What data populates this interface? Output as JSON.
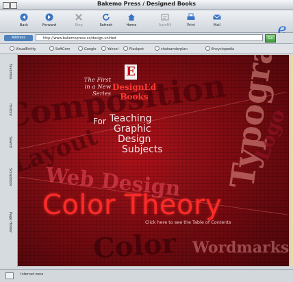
{
  "window": {
    "title": "Bakemo Press / Designed Books"
  },
  "toolbar": {
    "buttons": [
      {
        "label": "Back",
        "icon": "back-arrow-icon",
        "enabled": true
      },
      {
        "label": "Forward",
        "icon": "forward-arrow-icon",
        "enabled": true
      },
      {
        "label": "Stop",
        "icon": "stop-icon",
        "enabled": false
      },
      {
        "label": "Refresh",
        "icon": "refresh-icon",
        "enabled": true
      },
      {
        "label": "Home",
        "icon": "home-icon",
        "enabled": true
      },
      {
        "label": "AutoFill",
        "icon": "autofill-icon",
        "enabled": false
      },
      {
        "label": "Print",
        "icon": "print-icon",
        "enabled": true
      },
      {
        "label": "Mail",
        "icon": "mail-icon",
        "enabled": true
      }
    ]
  },
  "address": {
    "label": "Address",
    "url": "http://www.bakemopress.co/design.unlited",
    "go_label": "Go"
  },
  "favorites": [
    "VisualEntity",
    "SoftCom",
    "Google",
    "Yahoo!",
    "Flaskpot",
    "chatsanderplan",
    "Encyclopedia"
  ],
  "sidetabs": [
    "Favorites",
    "History",
    "Search",
    "Scrapbook",
    "Page Holder"
  ],
  "status": {
    "text": "Internet zone"
  },
  "page": {
    "tagline": [
      "The First",
      "in a New",
      "Series"
    ],
    "logo_mark": "E",
    "brand": [
      "DesignEd",
      "Books"
    ],
    "for_label": "For",
    "for_lines": [
      "Teaching",
      "Graphic",
      "Design",
      "Subjects"
    ],
    "headline": "Color Theory",
    "cta": "Click here to see the Table of Contents",
    "bg_words": [
      "Typography",
      "Web Design",
      "Composition",
      "Wordmarks",
      "Color",
      "Logo",
      "Layout"
    ]
  },
  "colors": {
    "accent_red": "#ff2a2a",
    "page_bg": "#7d0c12",
    "ie_blue": "#2d6fd6"
  }
}
